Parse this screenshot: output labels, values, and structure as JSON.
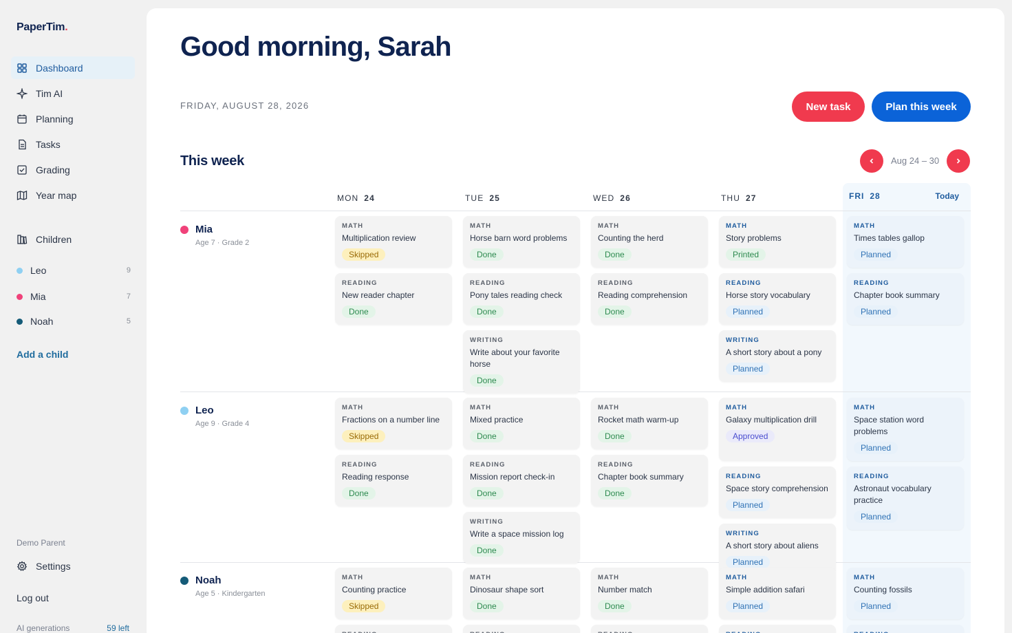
{
  "sidebar": {
    "brand": "PaperTim",
    "brand_dot": ".",
    "nav": [
      {
        "label": "Dashboard",
        "icon": "grid-icon"
      },
      {
        "label": "Tim AI",
        "icon": "sparkle-icon"
      },
      {
        "label": "Planning",
        "icon": "calendar-icon"
      },
      {
        "label": "Tasks",
        "icon": "document-icon"
      },
      {
        "label": "Grading",
        "icon": "checkbox-icon"
      },
      {
        "label": "Year map",
        "icon": "map-icon"
      },
      {
        "label": "Children",
        "icon": "children-icon"
      }
    ],
    "children": [
      {
        "name": "Leo",
        "count": "9",
        "color": "#8fd0f2"
      },
      {
        "name": "Mia",
        "count": "7",
        "color": "#f0427a"
      },
      {
        "name": "Noah",
        "count": "5",
        "color": "#155b78"
      }
    ],
    "add_child": "Add a child",
    "demo_parent": "Demo Parent",
    "settings": "Settings",
    "logout": "Log out",
    "ai_generations_label": "AI generations",
    "ai_generations_left": "59 left"
  },
  "header": {
    "greeting": "Good morning, Sarah",
    "date": "FRIDAY, AUGUST 28, 2026",
    "new_task": "New task",
    "plan_week": "Plan this week"
  },
  "week": {
    "title": "This week",
    "range": "Aug 24 – 30",
    "today_label": "Today",
    "days": [
      {
        "dow": "MON",
        "num": "24"
      },
      {
        "dow": "TUE",
        "num": "25"
      },
      {
        "dow": "WED",
        "num": "26"
      },
      {
        "dow": "THU",
        "num": "27"
      },
      {
        "dow": "FRI",
        "num": "28"
      }
    ]
  },
  "rows": [
    {
      "name": "Mia",
      "sub": "Age 7 · Grade 2",
      "color": "#f0427a",
      "days": [
        [
          {
            "s": "MATH",
            "t": "Multiplication review",
            "b": "Skipped"
          },
          {
            "s": "READING",
            "t": "New reader chapter",
            "b": "Done"
          }
        ],
        [
          {
            "s": "MATH",
            "t": "Horse barn word problems",
            "b": "Done"
          },
          {
            "s": "READING",
            "t": "Pony tales reading check",
            "b": "Done"
          },
          {
            "s": "WRITING",
            "t": "Write about your favorite horse",
            "b": "Done"
          }
        ],
        [
          {
            "s": "MATH",
            "t": "Counting the herd",
            "b": "Done"
          },
          {
            "s": "READING",
            "t": "Reading comprehension",
            "b": "Done"
          }
        ],
        [
          {
            "s": "MATH",
            "t": "Story problems",
            "b": "Printed"
          },
          {
            "s": "READING",
            "t": "Horse story vocabulary",
            "b": "Planned"
          },
          {
            "s": "WRITING",
            "t": "A short story about a pony",
            "b": "Planned"
          }
        ],
        [
          {
            "s": "MATH",
            "t": "Times tables gallop",
            "b": "Planned"
          },
          {
            "s": "READING",
            "t": "Chapter book summary",
            "b": "Planned"
          }
        ]
      ]
    },
    {
      "name": "Leo",
      "sub": "Age 9 · Grade 4",
      "color": "#8fd0f2",
      "days": [
        [
          {
            "s": "MATH",
            "t": "Fractions on a number line",
            "b": "Skipped"
          },
          {
            "s": "READING",
            "t": "Reading response",
            "b": "Done"
          }
        ],
        [
          {
            "s": "MATH",
            "t": "Mixed practice",
            "b": "Done"
          },
          {
            "s": "READING",
            "t": "Mission report check-in",
            "b": "Done"
          },
          {
            "s": "WRITING",
            "t": "Write a space mission log",
            "b": "Done"
          }
        ],
        [
          {
            "s": "MATH",
            "t": "Rocket math warm-up",
            "b": "Done"
          },
          {
            "s": "READING",
            "t": "Chapter book summary",
            "b": "Done"
          }
        ],
        [
          {
            "s": "MATH",
            "t": "Galaxy multiplication drill",
            "b": "Approved"
          },
          {
            "s": "READING",
            "t": "Space story comprehension",
            "b": "Planned"
          },
          {
            "s": "WRITING",
            "t": "A short story about aliens",
            "b": "Planned"
          }
        ],
        [
          {
            "s": "MATH",
            "t": "Space station word problems",
            "b": "Planned"
          },
          {
            "s": "READING",
            "t": "Astronaut vocabulary practice",
            "b": "Planned"
          }
        ]
      ]
    },
    {
      "name": "Noah",
      "sub": "Age 5 · Kindergarten",
      "color": "#155b78",
      "days": [
        [
          {
            "s": "MATH",
            "t": "Counting practice",
            "b": "Skipped"
          },
          {
            "s": "READING",
            "t": "",
            "b": ""
          }
        ],
        [
          {
            "s": "MATH",
            "t": "Dinosaur shape sort",
            "b": "Done"
          },
          {
            "s": "READING",
            "t": "",
            "b": ""
          }
        ],
        [
          {
            "s": "MATH",
            "t": "Number match",
            "b": "Done"
          },
          {
            "s": "READING",
            "t": "",
            "b": ""
          }
        ],
        [
          {
            "s": "MATH",
            "t": "Simple addition safari",
            "b": "Planned"
          },
          {
            "s": "READING",
            "t": "",
            "b": ""
          }
        ],
        [
          {
            "s": "MATH",
            "t": "Counting fossils",
            "b": "Planned"
          },
          {
            "s": "READING",
            "t": "",
            "b": ""
          }
        ]
      ]
    }
  ]
}
